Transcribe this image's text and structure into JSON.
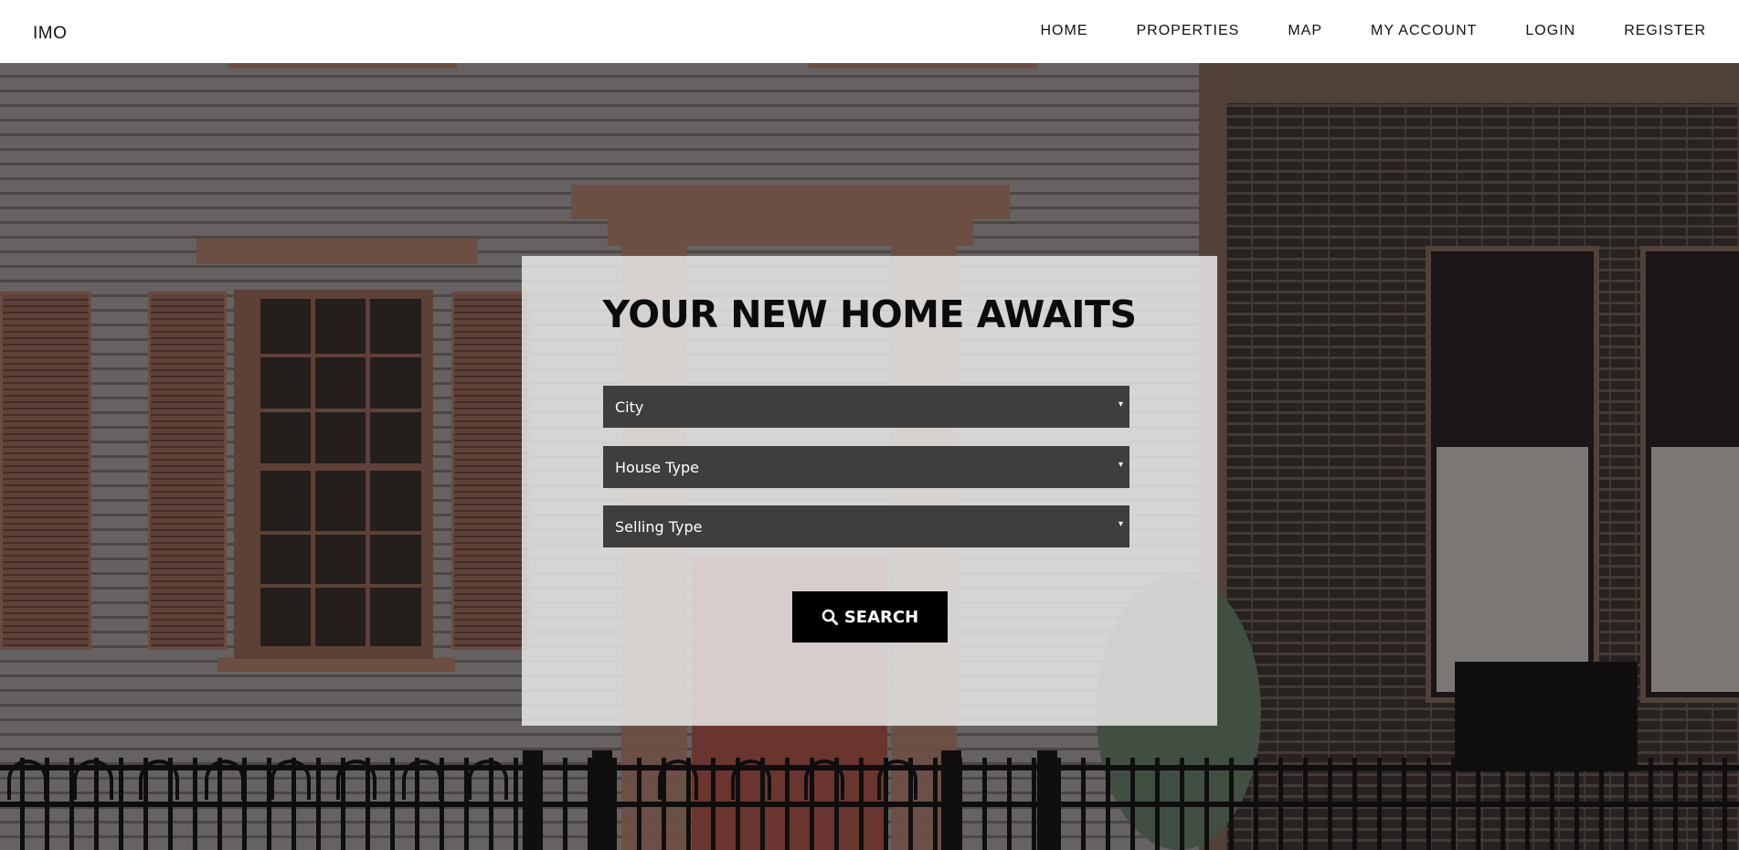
{
  "brand": {
    "name": "IMO"
  },
  "nav": {
    "items": [
      {
        "label": "HOME"
      },
      {
        "label": "PROPERTIES"
      },
      {
        "label": "MAP"
      },
      {
        "label": "MY ACCOUNT"
      },
      {
        "label": "LOGIN"
      },
      {
        "label": "REGISTER"
      }
    ]
  },
  "hero": {
    "background_description": "photo of house exterior with siding, brown shutters, red door, brick facade and iron fence"
  },
  "search": {
    "title": "YOUR NEW HOME AWAITS",
    "city": {
      "selected": "City"
    },
    "house_type": {
      "selected": "House Type"
    },
    "selling_type": {
      "selected": "Selling Type"
    },
    "button_label": "SEARCH",
    "button_icon": "search-icon",
    "caret_glyph": "▾"
  },
  "colors": {
    "navbar_bg": "#ffffff",
    "panel_bg": "#ebebeb",
    "select_bg": "#3e3e3e",
    "button_bg": "#000000",
    "text_dark": "#0b0b0b"
  }
}
